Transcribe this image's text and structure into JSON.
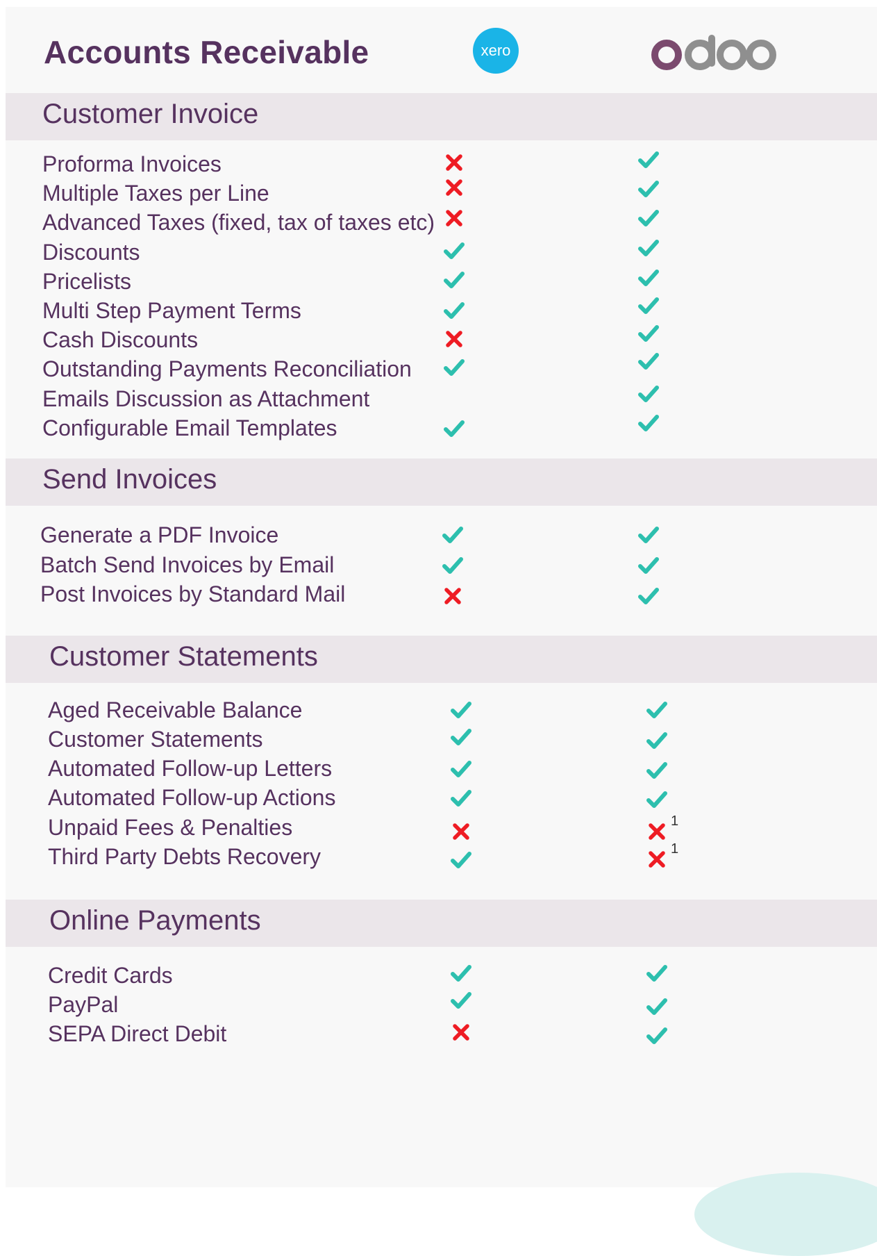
{
  "title": "Accounts Receivable",
  "logos": {
    "xero": "xero",
    "odoo": "odoo"
  },
  "colors": {
    "check": "#2dbfae",
    "cross": "#ee1c24",
    "text": "#56325f",
    "band": "#ebe6ea",
    "xero_blue": "#1ab4e7"
  },
  "sections": [
    {
      "title": "Customer Invoice",
      "rows": [
        {
          "label": "Proforma Invoices",
          "xero": "cross",
          "odoo": "check"
        },
        {
          "label": "Multiple Taxes per Line",
          "xero": "cross",
          "odoo": "check"
        },
        {
          "label": "Advanced Taxes (fixed, tax of taxes etc)",
          "xero": "cross",
          "odoo": "check"
        },
        {
          "label": "Discounts",
          "xero": "check",
          "odoo": "check"
        },
        {
          "label": "Pricelists",
          "xero": "check",
          "odoo": "check"
        },
        {
          "label": "Multi Step Payment Terms",
          "xero": "check",
          "odoo": "check"
        },
        {
          "label": "Cash Discounts",
          "xero": "cross",
          "odoo": "check"
        },
        {
          "label": "Outstanding Payments Reconciliation",
          "xero": "check",
          "odoo": "check"
        },
        {
          "label": "Emails Discussion as Attachment",
          "xero": "none",
          "odoo": "check"
        },
        {
          "label": "Configurable Email Templates",
          "xero": "check",
          "odoo": "check"
        }
      ]
    },
    {
      "title": "Send Invoices",
      "rows": [
        {
          "label": "Generate a PDF Invoice",
          "xero": "check",
          "odoo": "check"
        },
        {
          "label": "Batch Send Invoices by Email",
          "xero": "check",
          "odoo": "check"
        },
        {
          "label": "Post Invoices by Standard Mail",
          "xero": "cross",
          "odoo": "check"
        }
      ]
    },
    {
      "title": "Customer Statements",
      "rows": [
        {
          "label": "Aged Receivable Balance",
          "xero": "check",
          "odoo": "check"
        },
        {
          "label": "Customer Statements",
          "xero": "check",
          "odoo": "check"
        },
        {
          "label": "Automated Follow-up Letters",
          "xero": "check",
          "odoo": "check"
        },
        {
          "label": "Automated Follow-up Actions",
          "xero": "check",
          "odoo": "check"
        },
        {
          "label": "Unpaid Fees & Penalties",
          "xero": "cross",
          "odoo": "cross",
          "odoo_note": "1"
        },
        {
          "label": "Third Party Debts Recovery",
          "xero": "check",
          "odoo": "cross",
          "odoo_note": "1"
        }
      ]
    },
    {
      "title": "Online Payments",
      "rows": [
        {
          "label": "Credit Cards",
          "xero": "check",
          "odoo": "check"
        },
        {
          "label": "PayPal",
          "xero": "check",
          "odoo": "check"
        },
        {
          "label": "SEPA Direct Debit",
          "xero": "cross",
          "odoo": "check"
        }
      ]
    }
  ]
}
